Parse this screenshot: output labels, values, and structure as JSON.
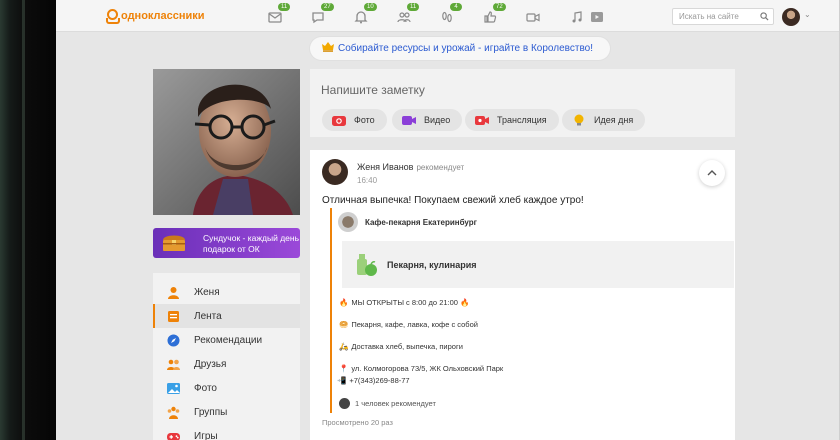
{
  "header": {
    "logo_text": "одноклассники",
    "search_placeholder": "Искать на сайте",
    "nav": [
      {
        "icon": "envelope-icon",
        "badge": "11"
      },
      {
        "icon": "chat-icon",
        "badge": "27"
      },
      {
        "icon": "bell-icon",
        "badge": "10"
      },
      {
        "icon": "friends-icon",
        "badge": "11"
      },
      {
        "icon": "guests-icon",
        "badge": "4"
      },
      {
        "icon": "like-icon",
        "badge": "72"
      },
      {
        "icon": "video-icon",
        "badge": ""
      },
      {
        "icon": "music-icon",
        "badge": ""
      },
      {
        "icon": "play-icon",
        "badge": ""
      }
    ]
  },
  "promo": {
    "text": "Собирайте ресурсы и урожай - играйте в Королевство!"
  },
  "gift_card": {
    "text": "Сундучок - каждый день подарок от ОК"
  },
  "menu": [
    {
      "label": "Женя",
      "icon": "user-icon",
      "active": false
    },
    {
      "label": "Лента",
      "icon": "feed-icon",
      "active": true
    },
    {
      "label": "Рекомендации",
      "icon": "compass-icon",
      "active": false
    },
    {
      "label": "Друзья",
      "icon": "friends-icon",
      "active": false
    },
    {
      "label": "Фото",
      "icon": "photo-icon",
      "active": false
    },
    {
      "label": "Группы",
      "icon": "groups-icon",
      "active": false
    },
    {
      "label": "Игры",
      "icon": "gamepad-icon",
      "active": false
    }
  ],
  "note": {
    "placeholder": "Напишите заметку",
    "actions": [
      {
        "label": "Фото",
        "icon": "camera-icon",
        "color": "#e8383d"
      },
      {
        "label": "Видео",
        "icon": "video-icon",
        "color": "#8b3fd8"
      },
      {
        "label": "Трансляция",
        "icon": "broadcast-icon",
        "color": "#e8383d"
      },
      {
        "label": "Идея дня",
        "icon": "bulb-icon",
        "color": "#f2b400"
      }
    ]
  },
  "post": {
    "author": "Женя Иванов",
    "action": "рекомендует",
    "time": "16:40",
    "text": "Отличная выпечка! Покупаем свежий хлеб каждое утро!",
    "shared": {
      "name": "Кафе-пекарня Екатеринбург",
      "category": "Пекарня, кулинария",
      "lines": [
        {
          "emoji": "🔥",
          "text": "МЫ ОТКРЫТЫ с 8:00 до 21:00 🔥"
        },
        {
          "emoji": "🥯",
          "text": "Пекарня, кафе, лавка, кофе с собой"
        },
        {
          "emoji": "🛵",
          "text": "Доставка хлеб, выпечка, пироги"
        },
        {
          "emoji": "📍",
          "text": "ул. Колмогорова 73/5, ЖК Ольховский Парк"
        },
        {
          "emoji": "📲",
          "text": "+7(343)269-88-77"
        }
      ],
      "recommend_count": "1 человек рекомендует"
    },
    "views": "Просмотрено 20 раз"
  },
  "colors": {
    "accent": "#ee8208",
    "badge": "#5fa938",
    "link": "#2c5bd1"
  }
}
